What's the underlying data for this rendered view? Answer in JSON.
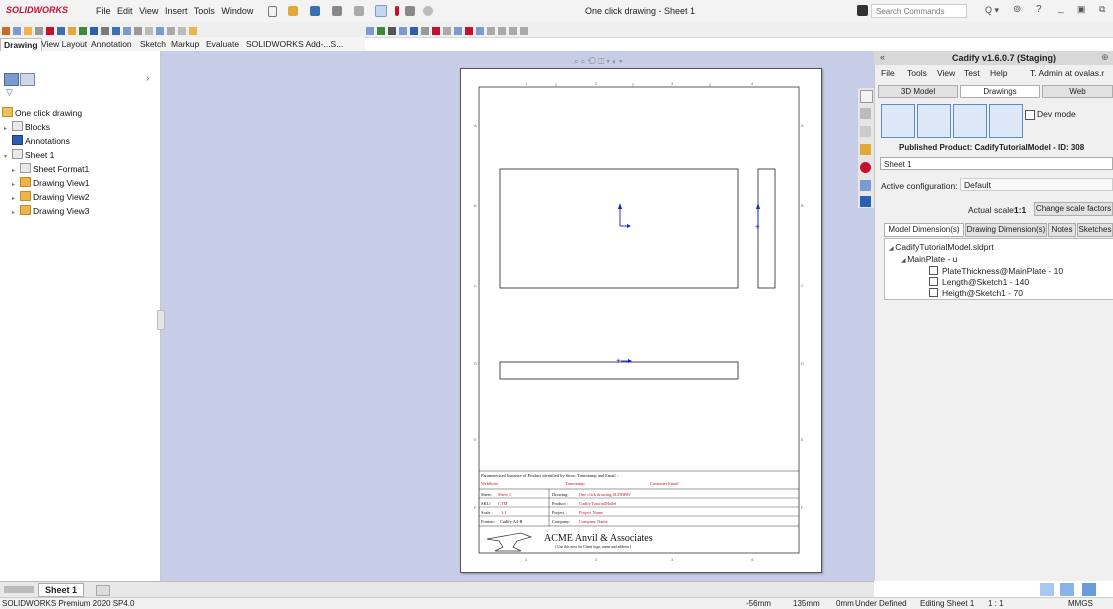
{
  "app": {
    "logo": "SOLIDWORKS",
    "menu": [
      "File",
      "Edit",
      "View",
      "Insert",
      "Tools",
      "Window"
    ],
    "title": "One click drawing - Sheet 1",
    "search_placeholder": "Search Commands"
  },
  "command_tabs": [
    "Drawing",
    "View Layout",
    "Annotation",
    "Sketch",
    "Markup",
    "Evaluate",
    "SOLIDWORKS Add-...S..."
  ],
  "tree": {
    "root": "One click drawing",
    "items": [
      "Blocks",
      "Annotations",
      "Sheet 1",
      "Sheet Format1",
      "Drawing View1",
      "Drawing View2",
      "Drawing View3"
    ]
  },
  "drawing": {
    "col_labels": [
      "1",
      "2",
      "3",
      "4"
    ],
    "row_labels": [
      "A",
      "B",
      "C",
      "D",
      "E",
      "F"
    ],
    "title_block": {
      "header": "Parameterised Instance of Product identified by Store, Timestamp and Email :",
      "store": "WebStore",
      "timestamp": "Timestamp",
      "email": "Customer Email",
      "sheet_label": "Sheet:",
      "sheet_value": "Sheet 1",
      "sku_label": "SKU:",
      "sku_value": "CTM",
      "scale_label": "Scale :",
      "scale_value": "1:1",
      "format_label": "Format:",
      "format_value": "Cadify A4-R",
      "drawing_label": "Drawing:",
      "drawing_value": "One click drawing.SLDDRW",
      "product_label": "Product :",
      "product_value": "CadifyTutorialModel",
      "project_label": "Project :",
      "project_value": "Project Name",
      "company_label": "Company:",
      "company_value": "Company Name",
      "company_title": "ACME Anvil & Associates",
      "company_sub": "( Use this area for Client logo, name and address )"
    }
  },
  "cadify": {
    "title": "Cadify v1.6.0.7 (Staging)",
    "menu": [
      "File",
      "Tools",
      "View",
      "Test",
      "Help"
    ],
    "user": "T. Admin at ovalas.r",
    "tabs": [
      "3D Model",
      "Drawings",
      "Web"
    ],
    "dev_mode": "Dev mode",
    "published": "Published Product: CadifyTutorialModel - ID: 308",
    "sheet_select": "Sheet 1",
    "active_config_label": "Active configuration:",
    "active_config_value": "Default",
    "actual_scale_label": "Actual scale:",
    "actual_scale_value": "1:1",
    "change_scale_button": "Change scale factors",
    "dim_tabs": [
      "Model Dimension(s)",
      "Drawing Dimension(s)",
      "Notes",
      "Sketches"
    ],
    "model_tree": {
      "root": "CadifyTutorialModel.sldprt",
      "child": "MainPlate - u",
      "dims": [
        "PlateThickness@MainPlate - 10",
        "Length@Sketch1 - 140",
        "Heigth@Sketch1 - 70"
      ]
    }
  },
  "sheet_tab": "Sheet 1",
  "status": {
    "product": "SOLIDWORKS Premium 2020 SP4.0",
    "x": "-56mm",
    "y": "135mm",
    "z": "0mm",
    "state": "Under Defined",
    "editing": "Editing Sheet 1",
    "scale": "1 : 1",
    "units": "MMGS"
  },
  "colors": {
    "accent_red": "#c8102e",
    "graphics_bg": "#c7cde6",
    "sketch_blue": "#1020d0",
    "tb_red": "#d0202a"
  }
}
